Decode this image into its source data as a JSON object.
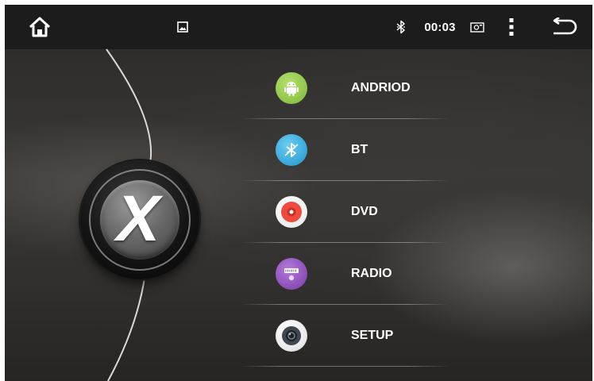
{
  "status_bar": {
    "clock": "00:03",
    "icons": {
      "home": "home-icon",
      "gallery": "image-icon",
      "bluetooth": "bluetooth-icon",
      "screenshot": "screenshot-icon",
      "more": "more-vertical-icon",
      "back": "back-icon"
    }
  },
  "logo": {
    "letter": "X"
  },
  "menu": {
    "items": [
      {
        "label": "ANDRIOD",
        "icon": "android-icon",
        "color": "#8bc34a"
      },
      {
        "label": "BT",
        "icon": "bluetooth-icon",
        "color": "#29a8e0"
      },
      {
        "label": "DVD",
        "icon": "disc-icon",
        "color": "#f24b3f"
      },
      {
        "label": "RADIO",
        "icon": "radio-icon",
        "color": "#8d4bbf"
      },
      {
        "label": "SETUP",
        "icon": "settings-icon",
        "color": "#5a6470"
      }
    ]
  }
}
